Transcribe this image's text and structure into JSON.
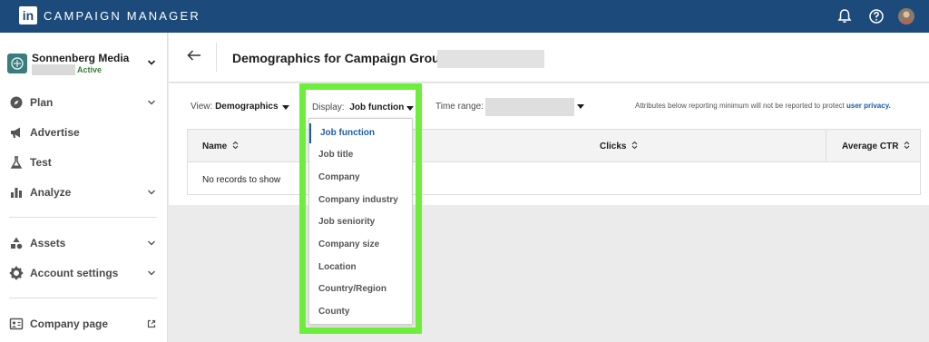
{
  "topbar": {
    "logo_text": "in",
    "app_title": "CAMPAIGN MANAGER",
    "icons": [
      "bell-icon",
      "help-icon",
      "user-avatar"
    ]
  },
  "sidebar": {
    "account": {
      "name": "Sonnenberg Media",
      "status": "Active"
    },
    "items": [
      {
        "label": "Plan",
        "icon": "compass-icon",
        "expandable": true
      },
      {
        "label": "Advertise",
        "icon": "megaphone-icon",
        "expandable": false
      },
      {
        "label": "Test",
        "icon": "flask-icon",
        "expandable": false
      },
      {
        "label": "Analyze",
        "icon": "bar-chart-icon",
        "expandable": true
      },
      {
        "label": "Assets",
        "icon": "shapes-icon",
        "expandable": true
      },
      {
        "label": "Account settings",
        "icon": "gear-icon",
        "expandable": true
      },
      {
        "label": "Company page",
        "icon": "company-page-icon",
        "external": true
      }
    ]
  },
  "header": {
    "title": "Demographics for Campaign Group:"
  },
  "filters": {
    "view_label": "View:",
    "view_value": "Demographics",
    "display_label": "Display:",
    "display_value": "Job function",
    "time_label": "Time range:",
    "privacy_text": "Attributes below reporting minimum will not be reported to protect",
    "privacy_link": "user privacy."
  },
  "table": {
    "columns": [
      "Name",
      "Clicks",
      "Average CTR"
    ],
    "empty_message": "No records to show"
  },
  "dropdown": {
    "options": [
      "Job function",
      "Job title",
      "Company",
      "Company industry",
      "Job seniority",
      "Company size",
      "Location",
      "Country/Region",
      "County"
    ],
    "selected": "Job function"
  },
  "colors": {
    "topbar": "#1c4a7a",
    "highlight": "#6cee3a",
    "link": "#1c5ca8",
    "status_active": "#3a7d3a"
  }
}
